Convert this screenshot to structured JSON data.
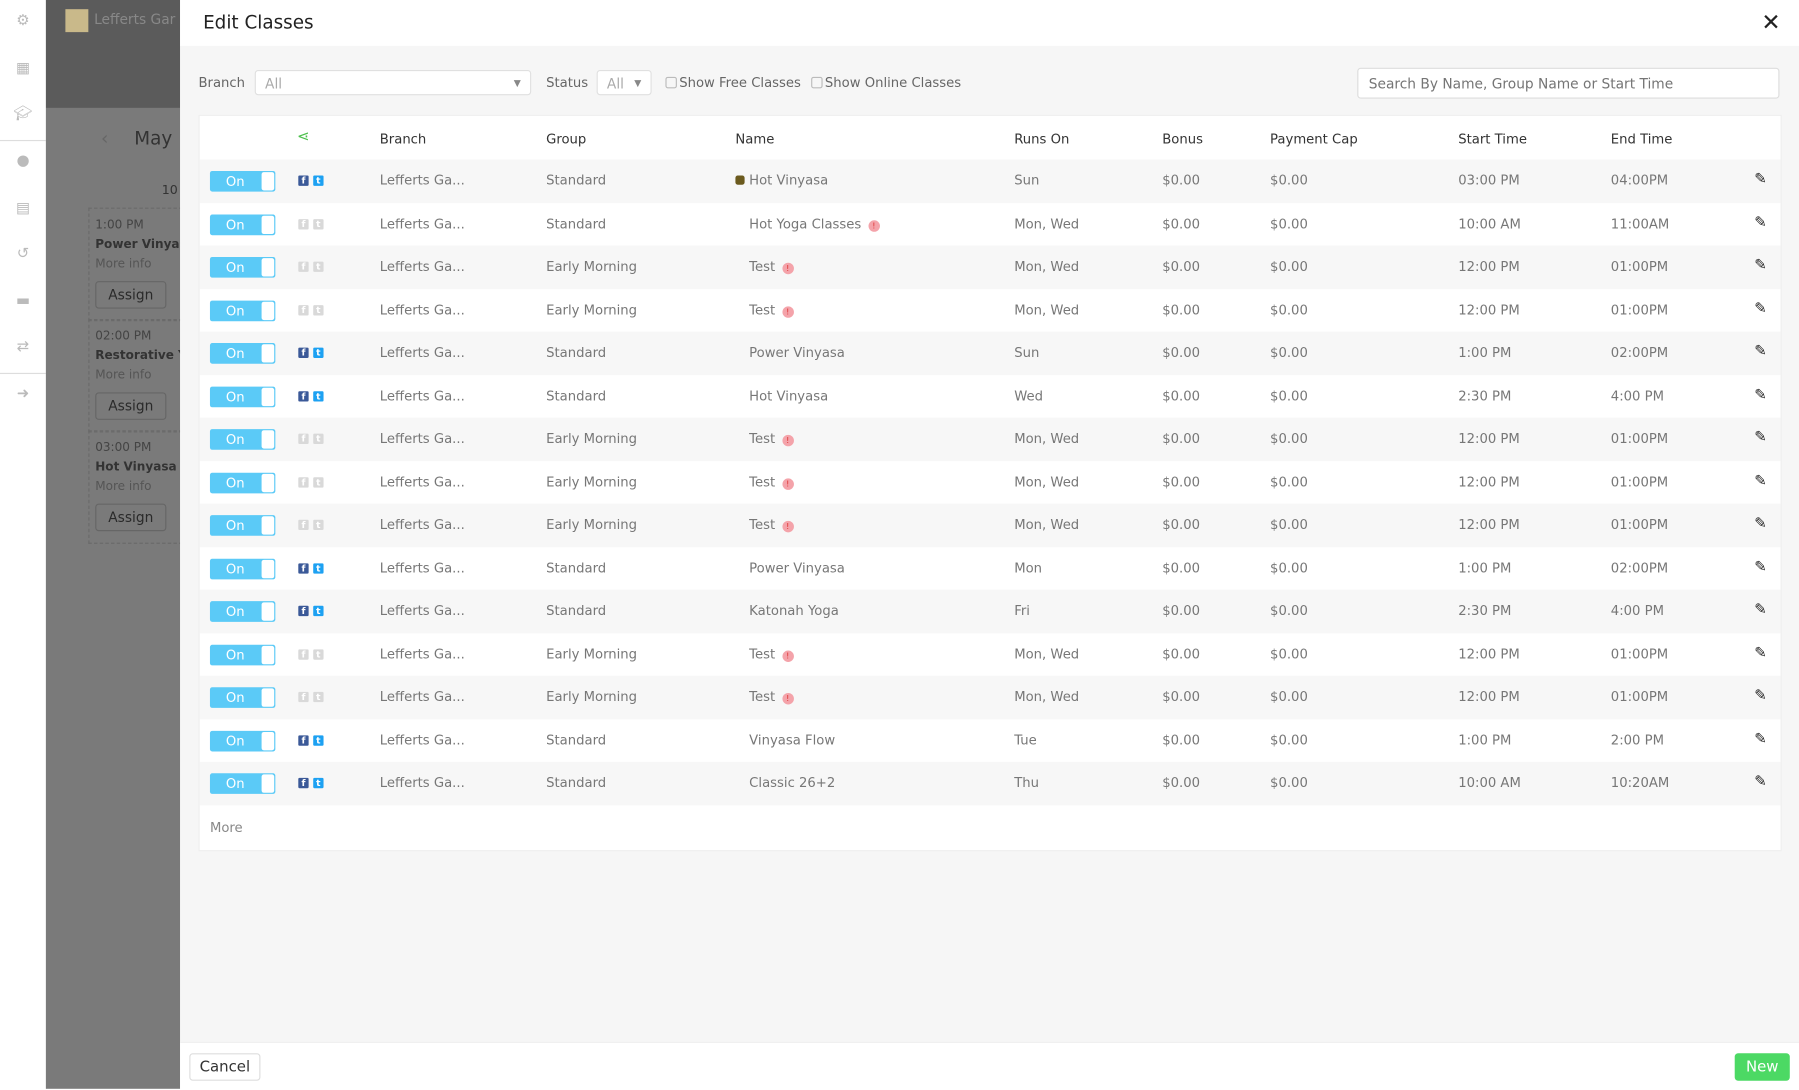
{
  "background": {
    "brand": "Lefferts Gar",
    "month": "May",
    "day": "10",
    "cards": [
      {
        "time": "1:00 PM",
        "name": "Power Vinyas",
        "more": "More info",
        "assign": "Assign"
      },
      {
        "time": "02:00 PM",
        "name": "Restorative Y",
        "more": "More info",
        "assign": "Assign"
      },
      {
        "time": "03:00 PM",
        "name": "Hot Vinyasa",
        "more": "More info",
        "assign": "Assign"
      }
    ]
  },
  "modal": {
    "title": "Edit Classes",
    "close": "✕",
    "filters": {
      "branch_label": "Branch",
      "branch_value": "All",
      "status_label": "Status",
      "status_value": "All",
      "free_label": "Show Free Classes",
      "online_label": "Show Online Classes",
      "search_placeholder": "Search By Name, Group Name or Start Time"
    },
    "columns": [
      "Branch",
      "Group",
      "Name",
      "Runs On",
      "Bonus",
      "Payment Cap",
      "Start Time",
      "End Time"
    ],
    "rows": [
      {
        "status": "On",
        "social": true,
        "branch": "Lefferts Ga...",
        "group": "Standard",
        "name": "Hot Vinyasa",
        "color": "#6b5a1e",
        "alert": false,
        "runs": "Sun",
        "bonus": "$0.00",
        "cap": "$0.00",
        "start": "03:00 PM",
        "end": "04:00PM"
      },
      {
        "status": "On",
        "social": false,
        "branch": "Lefferts Ga...",
        "group": "Standard",
        "name": "Hot Yoga Classes",
        "alert": true,
        "runs": "Mon, Wed",
        "bonus": "$0.00",
        "cap": "$0.00",
        "start": "10:00 AM",
        "end": "11:00AM"
      },
      {
        "status": "On",
        "social": false,
        "branch": "Lefferts Ga...",
        "group": "Early Morning",
        "name": "Test",
        "alert": true,
        "runs": "Mon, Wed",
        "bonus": "$0.00",
        "cap": "$0.00",
        "start": "12:00 PM",
        "end": "01:00PM"
      },
      {
        "status": "On",
        "social": false,
        "branch": "Lefferts Ga...",
        "group": "Early Morning",
        "name": "Test",
        "alert": true,
        "runs": "Mon, Wed",
        "bonus": "$0.00",
        "cap": "$0.00",
        "start": "12:00 PM",
        "end": "01:00PM"
      },
      {
        "status": "On",
        "social": true,
        "branch": "Lefferts Ga...",
        "group": "Standard",
        "name": "Power Vinyasa",
        "alert": false,
        "runs": "Sun",
        "bonus": "$0.00",
        "cap": "$0.00",
        "start": "1:00 PM",
        "end": "02:00PM"
      },
      {
        "status": "On",
        "social": true,
        "branch": "Lefferts Ga...",
        "group": "Standard",
        "name": "Hot Vinyasa",
        "alert": false,
        "runs": "Wed",
        "bonus": "$0.00",
        "cap": "$0.00",
        "start": "2:30 PM",
        "end": "4:00 PM"
      },
      {
        "status": "On",
        "social": false,
        "branch": "Lefferts Ga...",
        "group": "Early Morning",
        "name": "Test",
        "alert": true,
        "runs": "Mon, Wed",
        "bonus": "$0.00",
        "cap": "$0.00",
        "start": "12:00 PM",
        "end": "01:00PM"
      },
      {
        "status": "On",
        "social": false,
        "branch": "Lefferts Ga...",
        "group": "Early Morning",
        "name": "Test",
        "alert": true,
        "runs": "Mon, Wed",
        "bonus": "$0.00",
        "cap": "$0.00",
        "start": "12:00 PM",
        "end": "01:00PM"
      },
      {
        "status": "On",
        "social": false,
        "branch": "Lefferts Ga...",
        "group": "Early Morning",
        "name": "Test",
        "alert": true,
        "runs": "Mon, Wed",
        "bonus": "$0.00",
        "cap": "$0.00",
        "start": "12:00 PM",
        "end": "01:00PM"
      },
      {
        "status": "On",
        "social": true,
        "branch": "Lefferts Ga...",
        "group": "Standard",
        "name": "Power Vinyasa",
        "alert": false,
        "runs": "Mon",
        "bonus": "$0.00",
        "cap": "$0.00",
        "start": "1:00 PM",
        "end": "02:00PM"
      },
      {
        "status": "On",
        "social": true,
        "branch": "Lefferts Ga...",
        "group": "Standard",
        "name": "Katonah Yoga",
        "alert": false,
        "runs": "Fri",
        "bonus": "$0.00",
        "cap": "$0.00",
        "start": "2:30 PM",
        "end": "4:00 PM"
      },
      {
        "status": "On",
        "social": false,
        "branch": "Lefferts Ga...",
        "group": "Early Morning",
        "name": "Test",
        "alert": true,
        "runs": "Mon, Wed",
        "bonus": "$0.00",
        "cap": "$0.00",
        "start": "12:00 PM",
        "end": "01:00PM"
      },
      {
        "status": "On",
        "social": false,
        "branch": "Lefferts Ga...",
        "group": "Early Morning",
        "name": "Test",
        "alert": true,
        "runs": "Mon, Wed",
        "bonus": "$0.00",
        "cap": "$0.00",
        "start": "12:00 PM",
        "end": "01:00PM"
      },
      {
        "status": "On",
        "social": true,
        "branch": "Lefferts Ga...",
        "group": "Standard",
        "name": "Vinyasa Flow",
        "alert": false,
        "runs": "Tue",
        "bonus": "$0.00",
        "cap": "$0.00",
        "start": "1:00 PM",
        "end": "2:00 PM"
      },
      {
        "status": "On",
        "social": true,
        "branch": "Lefferts Ga...",
        "group": "Standard",
        "name": "Classic 26+2",
        "alert": false,
        "runs": "Thu",
        "bonus": "$0.00",
        "cap": "$0.00",
        "start": "10:00 AM",
        "end": "10:20AM"
      }
    ],
    "more": "More",
    "cancel": "Cancel",
    "new": "New"
  },
  "colors": {
    "toggle": "#5bcaf7",
    "new": "#4cd964",
    "share": "#4cc04c"
  }
}
